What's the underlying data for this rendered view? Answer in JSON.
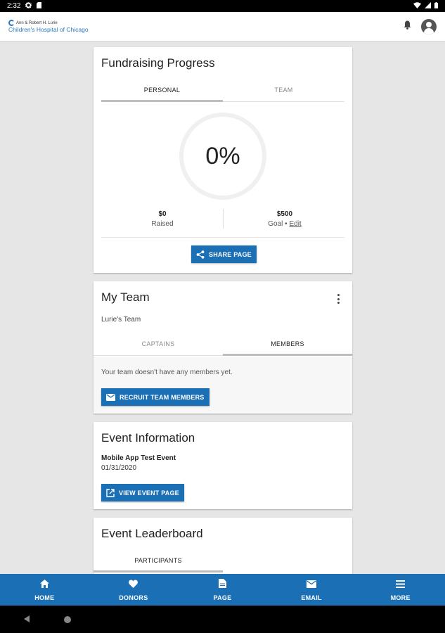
{
  "status_bar": {
    "time": "2:32"
  },
  "app_bar": {
    "logo_line1": "Ann & Robert H. Lurie",
    "logo_line2": "Children's Hospital of Chicago"
  },
  "fundraising": {
    "title": "Fundraising Progress",
    "tabs": [
      {
        "label": "PERSONAL",
        "active": true
      },
      {
        "label": "TEAM",
        "active": false
      }
    ],
    "progress_label": "0%",
    "progress_value": 0,
    "raised_amount": "$0",
    "raised_label": "Raised",
    "goal_amount": "$500",
    "goal_label": "Goal",
    "goal_separator": " • ",
    "edit_label": "Edit",
    "share_button": "SHARE PAGE"
  },
  "my_team": {
    "title": "My Team",
    "team_name": "Lurie's Team",
    "tabs": [
      {
        "label": "CAPTAINS",
        "active": false
      },
      {
        "label": "MEMBERS",
        "active": true
      }
    ],
    "empty_message": "Your team doesn't have any members yet.",
    "recruit_button": "RECRUIT TEAM MEMBERS"
  },
  "event_info": {
    "title": "Event Information",
    "event_name": "Mobile App Test Event",
    "event_date": "01/31/2020",
    "view_button": "VIEW EVENT PAGE"
  },
  "leaderboard": {
    "title": "Event Leaderboard",
    "tabs": [
      {
        "label": "PARTICIPANTS",
        "active": true
      }
    ]
  },
  "bottom_nav": {
    "items": [
      {
        "label": "HOME",
        "icon": "home-icon"
      },
      {
        "label": "DONORS",
        "icon": "heart-icon"
      },
      {
        "label": "PAGE",
        "icon": "page-icon"
      },
      {
        "label": "EMAIL",
        "icon": "email-icon"
      },
      {
        "label": "MORE",
        "icon": "menu-icon"
      }
    ]
  },
  "colors": {
    "primary": "#1a6fb5",
    "background": "#e6e6e6",
    "logo_blue": "#2b79c2"
  }
}
